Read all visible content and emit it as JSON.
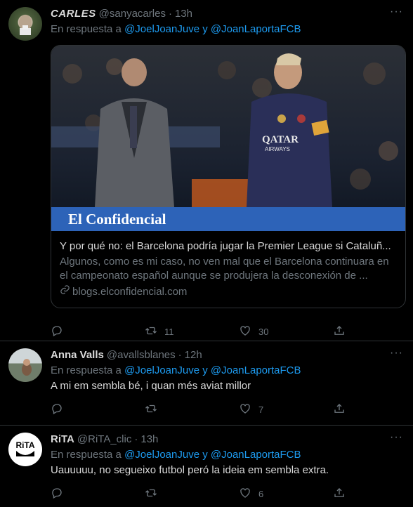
{
  "tweets": [
    {
      "name": "CARLES",
      "handle": "@sanyacarles",
      "dot": "·",
      "time": "13h",
      "reply_prefix": "En respuesta a",
      "reply_user1": "@JoelJoanJuve",
      "reply_and": "y",
      "reply_user2": "@JoanLaportaFCB",
      "card": {
        "image_caption": "El Confidencial",
        "sponsor_text": "QATAR AIRWAYS",
        "title": "Y por qué no: el Barcelona podría jugar la Premier League si Cataluñ...",
        "description": "Algunos, como es mi caso, no ven mal que el Barcelona continuara en el campeonato español aunque se produjera la desconexión de ...",
        "url": "blogs.elconfidencial.com"
      },
      "replies": "",
      "retweets": "11",
      "likes": "30"
    },
    {
      "name": "Anna Valls",
      "handle": "@avallsblanes",
      "dot": "·",
      "time": "12h",
      "reply_prefix": "En respuesta a",
      "reply_user1": "@JoelJoanJuve",
      "reply_and": "y",
      "reply_user2": "@JoanLaportaFCB",
      "text": "A mi em sembla bé, i quan més aviat millor",
      "replies": "",
      "retweets": "",
      "likes": "7"
    },
    {
      "name": "RiTA",
      "handle": "@RiTA_clic",
      "dot": "·",
      "time": "13h",
      "avatar_text": "RiTA",
      "reply_prefix": "En respuesta a",
      "reply_user1": "@JoelJoanJuve",
      "reply_and": "y",
      "reply_user2": "@JoanLaportaFCB",
      "text": "Uauuuuu, no segueixo futbol peró la ideia em sembla extra.",
      "replies": "",
      "retweets": "",
      "likes": "6"
    }
  ],
  "colors": {
    "background": "#000000",
    "text": "#d9d9d9",
    "muted": "#6e767d",
    "link": "#1d9bf0",
    "border": "#2f3336",
    "caption_bar": "#2d63b8"
  },
  "icons": [
    "reply-icon",
    "retweet-icon",
    "like-icon",
    "share-icon",
    "more-icon",
    "link-icon"
  ]
}
